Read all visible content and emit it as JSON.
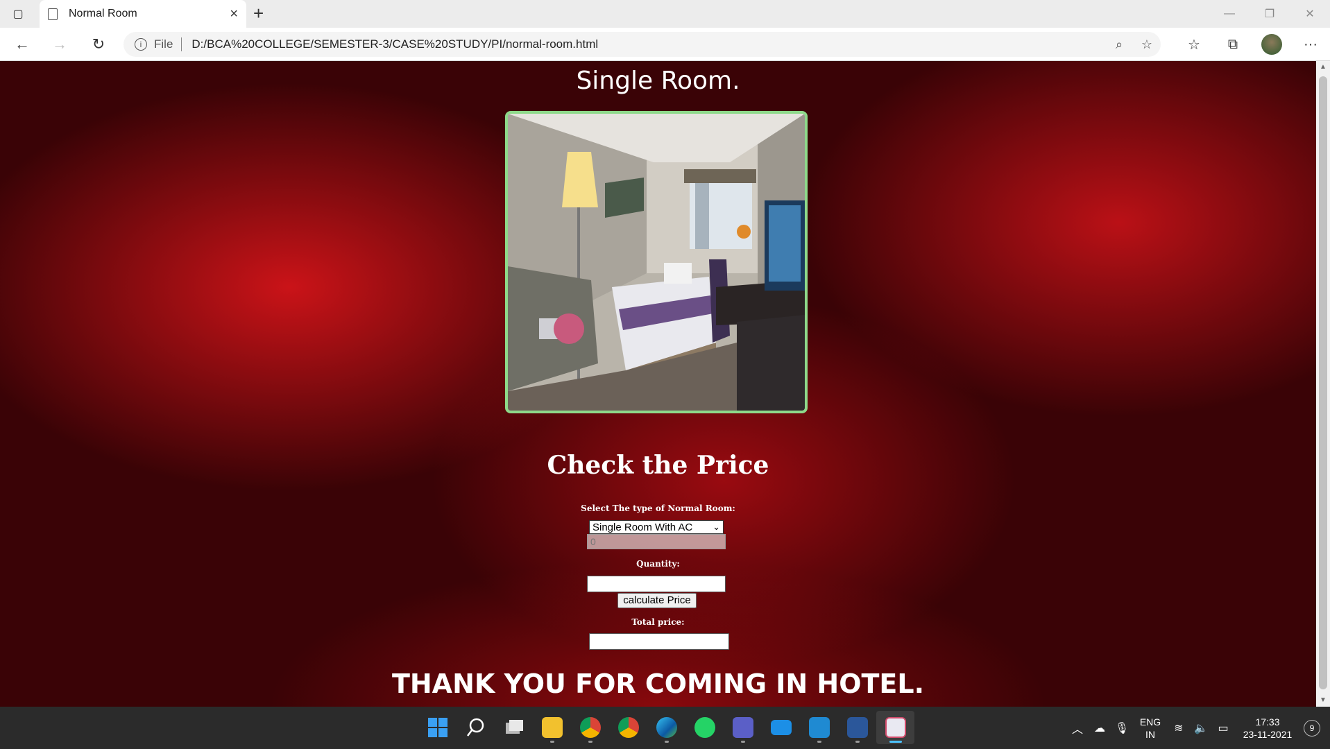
{
  "browser": {
    "tab_title": "Normal Room",
    "address_prefix": "File",
    "url": "D:/BCA%20COLLEGE/SEMESTER-3/CASE%20STUDY/PI/normal-room.html"
  },
  "page": {
    "title": "Single Room.",
    "image_alt": "Single room photo",
    "price_heading": "Check the Price",
    "select_label": "Select The type of Normal Room:",
    "room_type_selected": "Single Room With AC",
    "rate_value": "0",
    "quantity_label": "Quantity:",
    "quantity_value": "",
    "calc_button": "calculate Price",
    "total_label": "Total price:",
    "total_value": "",
    "footer": "THANK YOU FOR COMING IN HOTEL."
  },
  "taskbar": {
    "apps": [
      "start",
      "search",
      "task-view",
      "file-explorer",
      "chrome",
      "chrome-profile",
      "edge",
      "whatsapp",
      "teams",
      "mail",
      "vscode",
      "word",
      "snipping-tool"
    ],
    "lang_line1": "ENG",
    "lang_line2": "IN",
    "time": "17:33",
    "date": "23-11-2021",
    "notification_count": "9"
  },
  "colors": {
    "page_bg": "#8b0a12",
    "image_border": "#8ed98a",
    "text": "#ffffff"
  }
}
